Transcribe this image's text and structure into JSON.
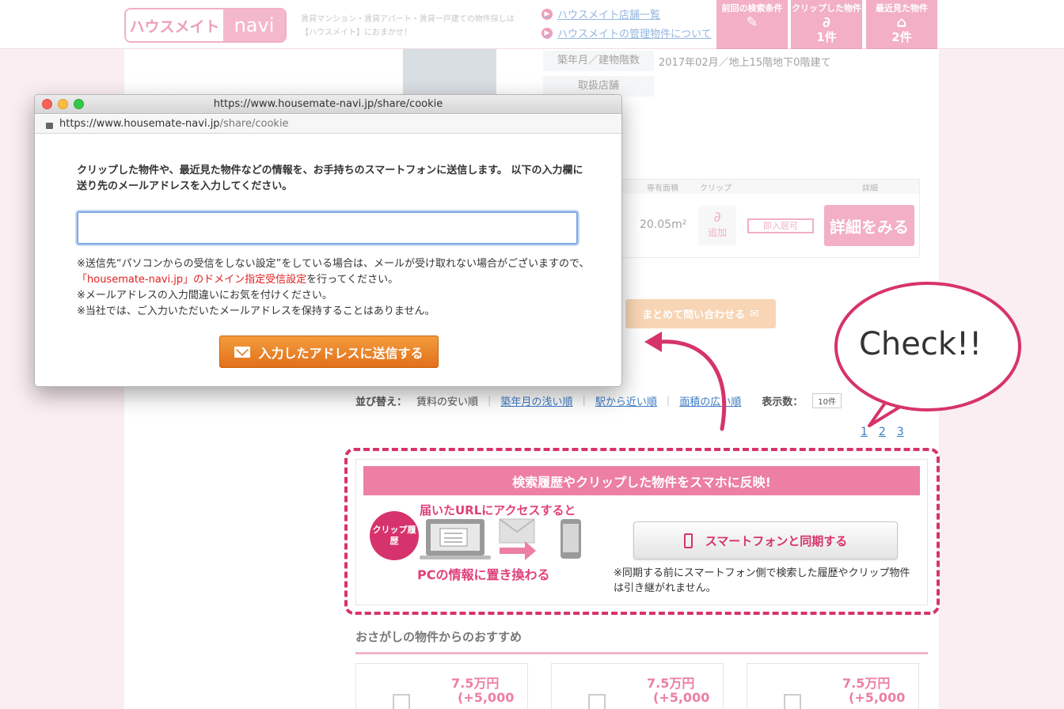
{
  "header": {
    "logo_left": "ハウスメイト",
    "logo_right": "navi",
    "tagline": "賃貸マンション・賃貸アパート・賃貸一戸建ての物件探しは【ハウスメイト】におまかせ！",
    "links": [
      "ハウスメイト店舗一覧",
      "ハウスメイトの管理物件について"
    ],
    "buttons": [
      {
        "label": "前回の検索条件",
        "count": ""
      },
      {
        "label": "クリップした物件",
        "count": "1件"
      },
      {
        "label": "最近見た物件",
        "count": "2件"
      }
    ]
  },
  "property": {
    "built_label": "築年月／建物階数",
    "built_value": "2017年02月／地上15階地下0階建て",
    "store_label": "取扱店舗",
    "table_headers": [
      "専有面積",
      "クリップ",
      "詳細"
    ],
    "area": "20.05m²",
    "clip_label": "追加",
    "available": "即入居可",
    "detail_button": "詳細をみる",
    "inquire_button": "まとめて問い合わせる"
  },
  "sort": {
    "label": "並び替え：",
    "options": [
      "賃料の安い順",
      "築年月の浅い順",
      "駅から近い順",
      "面積の広い順"
    ],
    "display_label": "表示数：",
    "display_value": "10件",
    "pages": [
      "1",
      "2",
      "3"
    ]
  },
  "sync": {
    "banner": "検索履歴やクリップした物件をスマホに反映!",
    "top_caption": "届いたURLにアクセスすると",
    "bottom_caption": "PCの情報に置き換わる",
    "badge": "クリップ履歴",
    "button": "スマートフォンと同期する",
    "note": "※同期する前にスマートフォン側で検索した履歴やクリップ物件は引き継がれません。"
  },
  "recommend": {
    "title": "おさがしの物件からのおすすめ",
    "cards": [
      {
        "price": "7.5万円",
        "extra": "(+5,000"
      },
      {
        "price": "7.5万円",
        "extra": "(+5,000"
      },
      {
        "price": "7.5万円",
        "extra": "(+5,000"
      }
    ]
  },
  "popup": {
    "title": "https://www.housemate-navi.jp/share/cookie",
    "url_host": "https://www.housemate-navi.jp",
    "url_path": "/share/cookie",
    "message": "クリップした物件や、最近見た物件などの情報を、お手持ちのスマートフォンに送信します。 以下の入力欄に送り先のメールアドレスを入力してください。",
    "input_value": "",
    "note1_a": "※送信先“パソコンからの受信をしない設定”をしている場合は、メールが受け取れない場合がございますので、",
    "note1_b": "「housemate-navi.jp」のドメイン指定受信設定",
    "note1_c": "を行ってください。",
    "note2": "※メールアドレスの入力間違いにお気を付けください。",
    "note3": "※当社では、ご入力いただいたメールアドレスを保持することはありません。",
    "send_button": "入力したアドレスに送信する"
  },
  "callout": {
    "text": "Check!!"
  },
  "colors": {
    "brand_pink": "#e96e99",
    "accent_orange": "#e2701a",
    "callout_magenta": "#d6336c",
    "link_blue": "#3c7bc4"
  }
}
